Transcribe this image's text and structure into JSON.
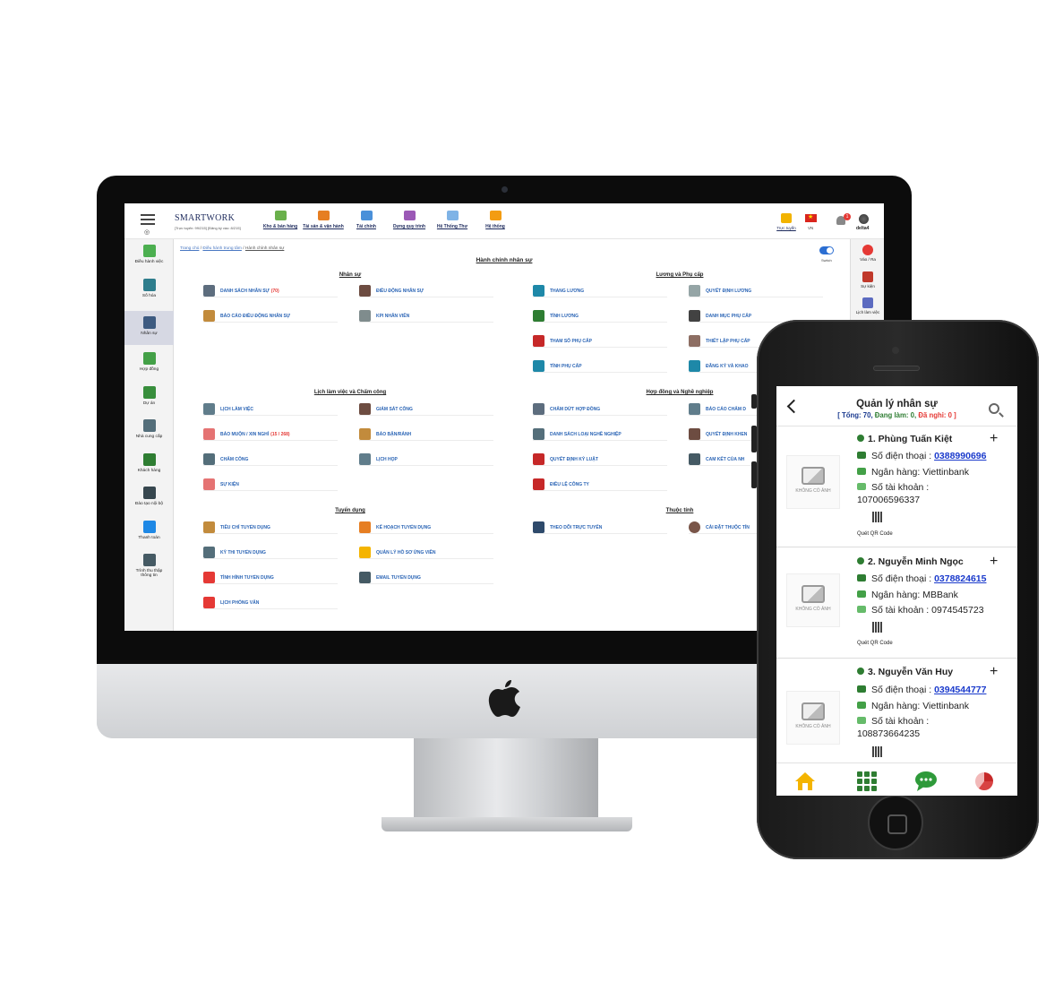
{
  "desktop": {
    "brand": "SMARTWORK",
    "brand_sub": "[Trực tuyến: 99/215] [Đăng ký vào: 8/215]",
    "top_nav": [
      {
        "label": "Kho & bán hàng",
        "color": "#6ab04c"
      },
      {
        "label": "Tài sản & vận hành",
        "color": "#e67e22"
      },
      {
        "label": "Tài chính",
        "color": "#4a90d9"
      },
      {
        "label": "Dựng quy trình",
        "color": "#9b59b6"
      },
      {
        "label": "Hệ Thống Thư",
        "color": "#7fb3e6"
      },
      {
        "label": "Hệ thống",
        "color": "#f39c12"
      }
    ],
    "top_right": {
      "online_label": "Trực tuyến",
      "lang": "VN",
      "notif_count": "1",
      "username": "delta4"
    },
    "sidebar": [
      {
        "label": "Điều hành việc",
        "color": "#4caf50"
      },
      {
        "label": "Số hóa",
        "color": "#2e7d8c"
      },
      {
        "label": "Nhân sự",
        "color": "#3d5a80"
      },
      {
        "label": "Hợp đồng",
        "color": "#43a047"
      },
      {
        "label": "Dự án",
        "color": "#388e3c"
      },
      {
        "label": "Nhà cung cấp",
        "color": "#546e7a"
      },
      {
        "label": "Khách hàng",
        "color": "#2e7d32"
      },
      {
        "label": "Đào tạo nội bộ",
        "color": "#37474f"
      },
      {
        "label": "Thanh toán",
        "color": "#1e88e5"
      },
      {
        "label": "Trình thu thập thông tin",
        "color": "#455a64"
      }
    ],
    "breadcrumb": {
      "home": "Trang chủ",
      "center": "Điều hành trung tâm",
      "current": "Hành chính nhân sự"
    },
    "page_title": "Hành chính nhân sự",
    "switch_label": "Switch",
    "right_sidebar": [
      {
        "label": "Vào / Ra",
        "color": "#e53935"
      },
      {
        "label": "Sự kiện",
        "color": "#c0392b"
      },
      {
        "label": "Lịch làm việc",
        "color": "#5c6bc0"
      }
    ],
    "sections": {
      "nhan_su": {
        "title": "Nhân sự",
        "items": [
          {
            "label": "DANH SÁCH NHÂN SỰ",
            "count": "(70)",
            "color": "#5d6d7e"
          },
          {
            "label": "ĐIỀU ĐỘNG NHÂN SỰ",
            "color": "#6d4c41"
          },
          {
            "label": "BÁO CÁO ĐIỀU ĐỘNG NHÂN SỰ",
            "color": "#c28b3c"
          },
          {
            "label": "KPI NHÂN VIÊN",
            "color": "#7f8c8d"
          }
        ]
      },
      "luong": {
        "title": "Lương và Phụ cấp",
        "items": [
          {
            "label": "THANG LƯƠNG",
            "color": "#1e88a8"
          },
          {
            "label": "QUYẾT ĐỊNH LƯƠNG",
            "color": "#95a5a6"
          },
          {
            "label": "TÍNH LƯƠNG",
            "color": "#2e7d32"
          },
          {
            "label": "DANH MỤC PHỤ CẤP",
            "color": "#424242"
          },
          {
            "label": "THAM SỐ PHỤ CẤP",
            "color": "#c62828"
          },
          {
            "label": "THIẾT LẬP PHỤ CẤP",
            "color": "#8d6e63"
          },
          {
            "label": "TÍNH PHỤ CẤP",
            "color": "#1e88a8"
          },
          {
            "label": "ĐĂNG KÝ VÀ KHAO",
            "color": "#1e88a8"
          }
        ]
      },
      "lich": {
        "title": "Lịch làm việc và Chấm công",
        "items": [
          {
            "label": "LỊCH LÀM VIỆC",
            "color": "#607d8b"
          },
          {
            "label": "GIÁM SÁT CÔNG",
            "color": "#6d4c41"
          },
          {
            "label": "BÁO MUỘN / XIN NGHỈ",
            "count": "(15 / 268)",
            "color": "#e57373"
          },
          {
            "label": "BÁO BẬN/RẢNH",
            "color": "#c28b3c"
          },
          {
            "label": "CHẤM CÔNG",
            "color": "#546e7a"
          },
          {
            "label": "LỊCH HỌP",
            "color": "#607d8b"
          },
          {
            "label": "SỰ KIỆN",
            "color": "#e57373"
          }
        ]
      },
      "hopdong": {
        "title": "Hợp đồng và Nghề nghiệp",
        "items": [
          {
            "label": "CHẤM DỨT HỢP ĐỒNG",
            "color": "#5d6d7e"
          },
          {
            "label": "BÁO CÁO CHẤM D",
            "color": "#607d8b"
          },
          {
            "label": "DANH SÁCH LOẠI NGHỀ NGHIỆP",
            "color": "#546e7a"
          },
          {
            "label": "QUYẾT ĐỊNH KHEN",
            "color": "#6d4c41"
          },
          {
            "label": "QUYẾT ĐỊNH KỶ LUẬT",
            "color": "#c62828"
          },
          {
            "label": "CAM KẾT CỦA NH",
            "color": "#455a64"
          },
          {
            "label": "ĐIỀU LỆ CÔNG TY",
            "color": "#c62828"
          }
        ]
      },
      "tuyendung": {
        "title": "Tuyển dụng",
        "items": [
          {
            "label": "TIÊU CHÍ TUYỂN DỤNG",
            "color": "#c28b3c"
          },
          {
            "label": "KẾ HOẠCH TUYỂN DỤNG",
            "color": "#e67e22"
          },
          {
            "label": "KỲ THI TUYỂN DỤNG",
            "color": "#546e7a"
          },
          {
            "label": "QUẢN LÝ HỒ SƠ ỨNG VIÊN",
            "color": "#f4b400"
          },
          {
            "label": "TÌNH HÌNH TUYỂN DỤNG",
            "color": "#e53935"
          },
          {
            "label": "EMAIL TUYỂN DỤNG",
            "color": "#455a64"
          },
          {
            "label": "LỊCH PHỎNG VẤN",
            "color": "#e53935"
          }
        ]
      },
      "thuoctinh": {
        "title": "Thuộc tính",
        "items": [
          {
            "label": "THEO DÕI TRỰC TUYẾN",
            "color": "#2e4a6b"
          },
          {
            "label": "CÀI ĐẶT THUỘC TÍN",
            "color": "#795548"
          }
        ]
      }
    }
  },
  "mobile": {
    "title": "Quản lý nhân sự",
    "summary": {
      "total": "[ Tổng: 70,",
      "working": "Đang làm: 0,",
      "off": "Đã nghỉ: 0 ]"
    },
    "no_image": "KHÔNG CÓ ẢNH",
    "phone_label": "Số điện thoại :",
    "bank_label": "Ngân hàng:",
    "account_label": "Số tài khoản :",
    "qr_label": "Quét QR Code",
    "employees": [
      {
        "name": "1. Phùng Tuấn Kiệt",
        "phone": "0388990696",
        "bank": "Viettinbank",
        "account": "107006596337"
      },
      {
        "name": "2. Nguyễn Minh Ngọc",
        "phone": "0378824615",
        "bank": "MBBank",
        "account": "0974545723"
      },
      {
        "name": "3. Nguyễn Văn Huy",
        "phone": "0394544777",
        "bank": "Viettinbank",
        "account": "108873664235"
      }
    ],
    "tabs": [
      {
        "icon": "home-icon",
        "color": "#f4b400"
      },
      {
        "icon": "grid-icon",
        "color": "#2e7d32"
      },
      {
        "icon": "chat-icon",
        "color": "#2e7d32"
      },
      {
        "icon": "pie-chart-icon",
        "color": "#c62828"
      }
    ]
  }
}
